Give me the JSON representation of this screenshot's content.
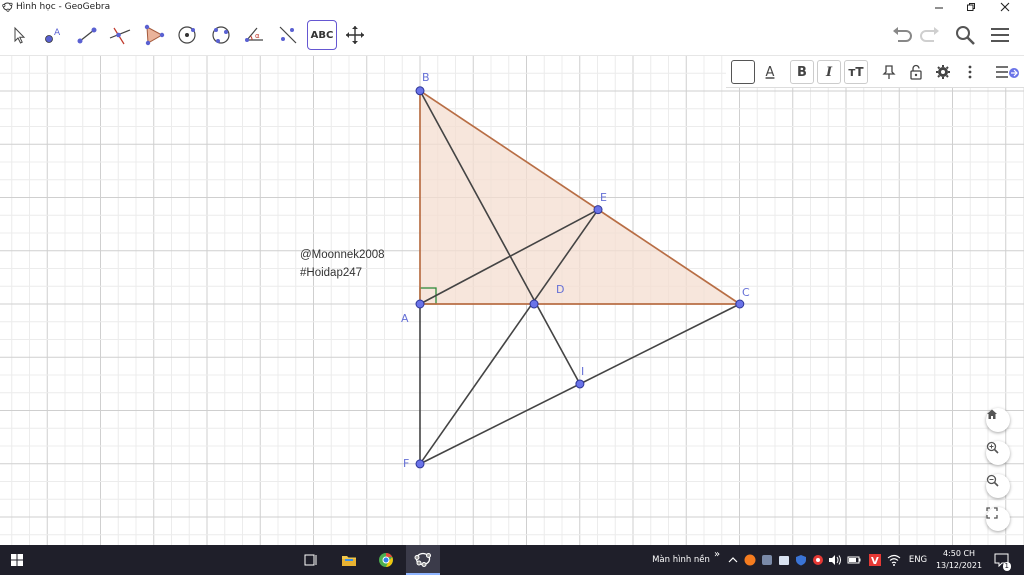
{
  "window": {
    "title": "Hình học - GeoGebra"
  },
  "toolbar": {
    "tools": [
      {
        "name": "move-tool-icon"
      },
      {
        "name": "point-tool-icon"
      },
      {
        "name": "segment-tool-icon"
      },
      {
        "name": "perpendicular-line-tool-icon"
      },
      {
        "name": "polygon-tool-icon"
      },
      {
        "name": "circle-center-point-tool-icon"
      },
      {
        "name": "circle-three-points-tool-icon"
      },
      {
        "name": "angle-tool-icon"
      },
      {
        "name": "reflect-tool-icon"
      },
      {
        "name": "text-tool-icon",
        "label": "ABC"
      },
      {
        "name": "move-graphics-view-tool-icon"
      }
    ],
    "text_tool_label": "ABC"
  },
  "stylebar": {
    "text_color_label": "A",
    "bold_label": "B",
    "italic_label": "I",
    "size_label": "тT"
  },
  "construction": {
    "points": [
      {
        "name": "A",
        "x": 0,
        "y": 0
      },
      {
        "name": "B",
        "x": 0,
        "y": 4
      },
      {
        "name": "C",
        "x": 6,
        "y": 0
      },
      {
        "name": "D",
        "x": 2.14,
        "y": 0
      },
      {
        "name": "E",
        "x": 3.34,
        "y": 1.77
      },
      {
        "name": "F",
        "x": 0,
        "y": -3
      },
      {
        "name": "I",
        "x": 3.0,
        "y": -1.5
      }
    ],
    "triangle": [
      "A",
      "B",
      "C"
    ],
    "segments": [
      [
        "A",
        "B"
      ],
      [
        "B",
        "C"
      ],
      [
        "C",
        "A"
      ],
      [
        "B",
        "I"
      ],
      [
        "A",
        "E"
      ],
      [
        "F",
        "E"
      ],
      [
        "A",
        "F"
      ],
      [
        "F",
        "C"
      ]
    ],
    "right_angle_at": "A",
    "colors": {
      "triangle_fill": "#f4ddd0",
      "triangle_stroke": "#b86e45",
      "segment": "#444444",
      "point_fill": "#6a73e8",
      "point_stroke": "#2d3596",
      "label": "#6570d6",
      "grid_minor": "#ececec",
      "grid_major": "#cfcfcf"
    }
  },
  "captions": {
    "line1": "@Moonnek2008",
    "line2": "#Hoidap247"
  },
  "taskbar": {
    "desktop_label": "Màn hình nền",
    "chevron": "»",
    "language": "ENG",
    "time": "4:50 CH",
    "date": "13/12/2021",
    "notification_count": "1"
  }
}
